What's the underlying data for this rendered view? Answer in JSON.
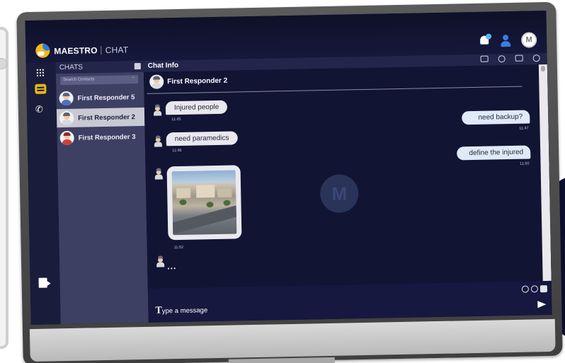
{
  "app": {
    "brand": "MAESTRO",
    "brand_sub": "CHAT",
    "avatar_initial": "M",
    "watermark": "M"
  },
  "rail": {
    "icons": [
      "apps-grid-icon",
      "chats-icon",
      "phone-icon",
      "logout-icon"
    ]
  },
  "contacts": {
    "title": "CHATS",
    "search_placeholder": "Search Contacts",
    "items": [
      {
        "name": "First Responder 5",
        "active": false,
        "hat_color": "#5b6283",
        "body_color": "#4b72c9"
      },
      {
        "name": "First Responder 2",
        "active": true,
        "hat_color": "#5f6270",
        "body_color": "#d9d9de"
      },
      {
        "name": "First Responder 3",
        "active": false,
        "hat_color": "#8b2d2d",
        "body_color": "#c9433a"
      }
    ]
  },
  "chat": {
    "header": "Chat Info",
    "recipient": "First Responder 2",
    "messages": [
      {
        "direction": "in",
        "text": "Injured people",
        "time": "11:45"
      },
      {
        "direction": "out",
        "text": "need backup?",
        "time": "11:47"
      },
      {
        "direction": "in",
        "text": "need paramedics",
        "time": "11:48"
      },
      {
        "direction": "out",
        "text": "define the injured",
        "time": "11:50"
      },
      {
        "direction": "in",
        "type": "image",
        "time": "11:52"
      }
    ],
    "typing": "..."
  },
  "composer": {
    "placeholder_cap": "T",
    "placeholder_rest": "ype a message"
  },
  "colors": {
    "screen_bg": "#11132f",
    "accent_yellow": "#e6b80f",
    "active_contact": "#c9c9d3"
  }
}
